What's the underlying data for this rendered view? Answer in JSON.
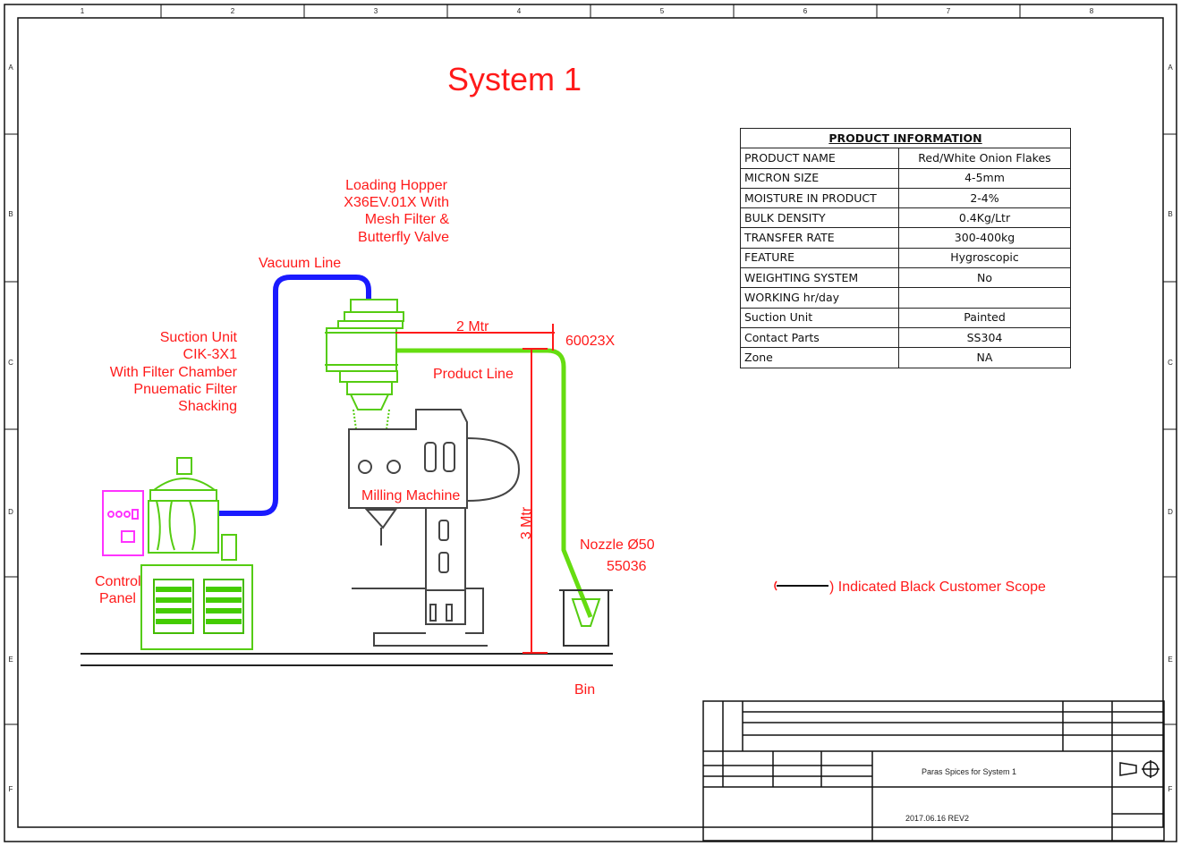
{
  "title": "System 1",
  "labels": {
    "loading_hopper": [
      "Loading Hopper",
      "X36EV.01X  With",
      "Mesh Filter &",
      "Butterfly Valve"
    ],
    "vacuum_line": "Vacuum Line",
    "suction_unit": [
      "Suction Unit",
      "CIK-3X1",
      "With Filter Chamber",
      "Pnuematic Filter",
      "Shacking"
    ],
    "two_mtr": "2 Mtr",
    "code_60023x": "60023X",
    "product_line": "Product  Line",
    "three_mtr": "3 Mtr",
    "milling_machine": "Milling Machine",
    "nozzle": [
      "Nozzle Ø50",
      "55036"
    ],
    "control_panel": [
      "Control",
      "Panel"
    ],
    "bin": "Bin",
    "customer_scope": ") Indicated Black Customer Scope"
  },
  "product_info": {
    "header": "PRODUCT INFORMATION",
    "rows": [
      {
        "key": "PRODUCT NAME",
        "value": "Red/White Onion Flakes"
      },
      {
        "key": "MICRON SIZE",
        "value": "4-5mm"
      },
      {
        "key": "MOISTURE  IN PRODUCT",
        "value": "2-4%"
      },
      {
        "key": "BULK DENSITY",
        "value": "0.4Kg/Ltr"
      },
      {
        "key": "TRANSFER RATE",
        "value": "300-400kg"
      },
      {
        "key": "FEATURE",
        "value": "Hygroscopic"
      },
      {
        "key": "WEIGHTING SYSTEM",
        "value": "No"
      },
      {
        "key": "WORKING hr/day",
        "value": ""
      },
      {
        "key": "Suction Unit",
        "value": "Painted"
      },
      {
        "key": "Contact Parts",
        "value": "SS304"
      },
      {
        "key": "Zone",
        "value": "NA"
      }
    ]
  },
  "title_block": {
    "project": "Paras Spices for System  1",
    "date_rev": "2017.06.16 REV2"
  },
  "frame": {
    "columns": [
      "1",
      "2",
      "3",
      "4",
      "5",
      "6",
      "7",
      "8"
    ],
    "rows": [
      "A",
      "B",
      "C",
      "D",
      "E",
      "F"
    ]
  },
  "colors": {
    "annotation": "#ff1a1a",
    "vacuum_line": "#1a1aff",
    "product_line": "#66dd11",
    "equipment_outline": "#55cc11",
    "control_panel": "#ff33ff"
  }
}
